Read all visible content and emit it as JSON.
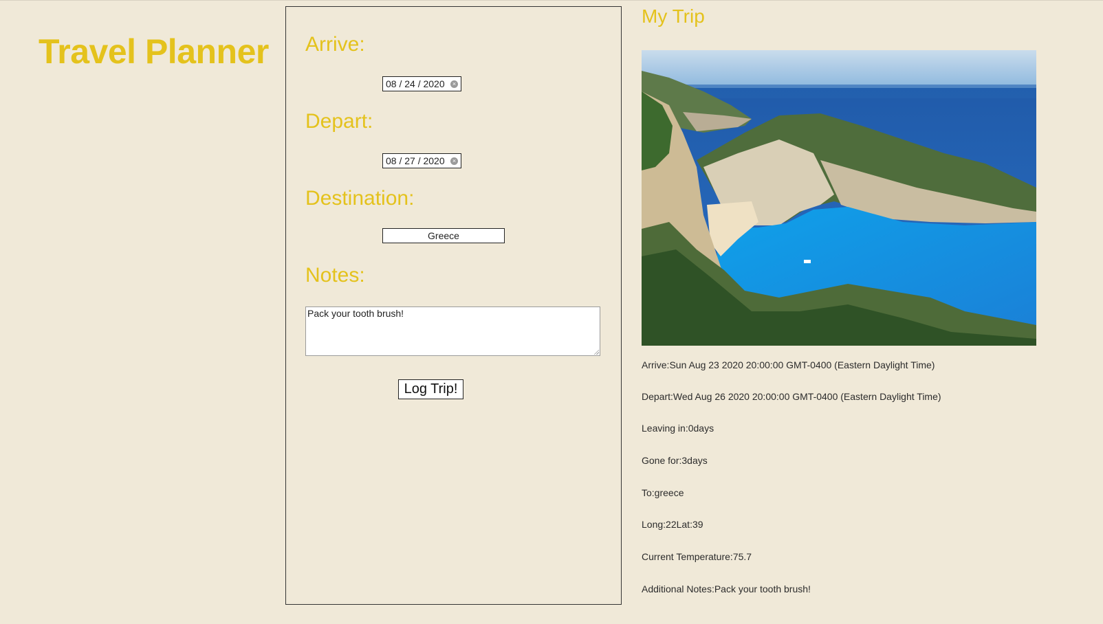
{
  "app": {
    "title": "Travel Planner"
  },
  "form": {
    "arrive_label": "Arrive:",
    "arrive_value": "08 / 24 / 2020",
    "depart_label": "Depart:",
    "depart_value": "08 / 27 / 2020",
    "destination_label": "Destination:",
    "destination_value": "Greece",
    "notes_label": "Notes:",
    "notes_value": "Pack your tooth brush!",
    "submit_label": "Log Trip!"
  },
  "trip": {
    "heading": "My Trip",
    "photo_icon": "beach-cove-photo",
    "arrive": "Arrive:Sun Aug 23 2020 20:00:00 GMT-0400 (Eastern Daylight Time)",
    "depart": "Depart:Wed Aug 26 2020 20:00:00 GMT-0400 (Eastern Daylight Time)",
    "leaving_in": "Leaving in:0days",
    "gone_for": "Gone for:3days",
    "to": "To:greece",
    "coords": "Long:22Lat:39",
    "temperature": "Current Temperature:75.7",
    "notes": "Additional Notes:Pack your tooth brush!"
  },
  "colors": {
    "background": "#f0e9d8",
    "accent": "#e4c21c",
    "text": "#2b2b2b"
  }
}
